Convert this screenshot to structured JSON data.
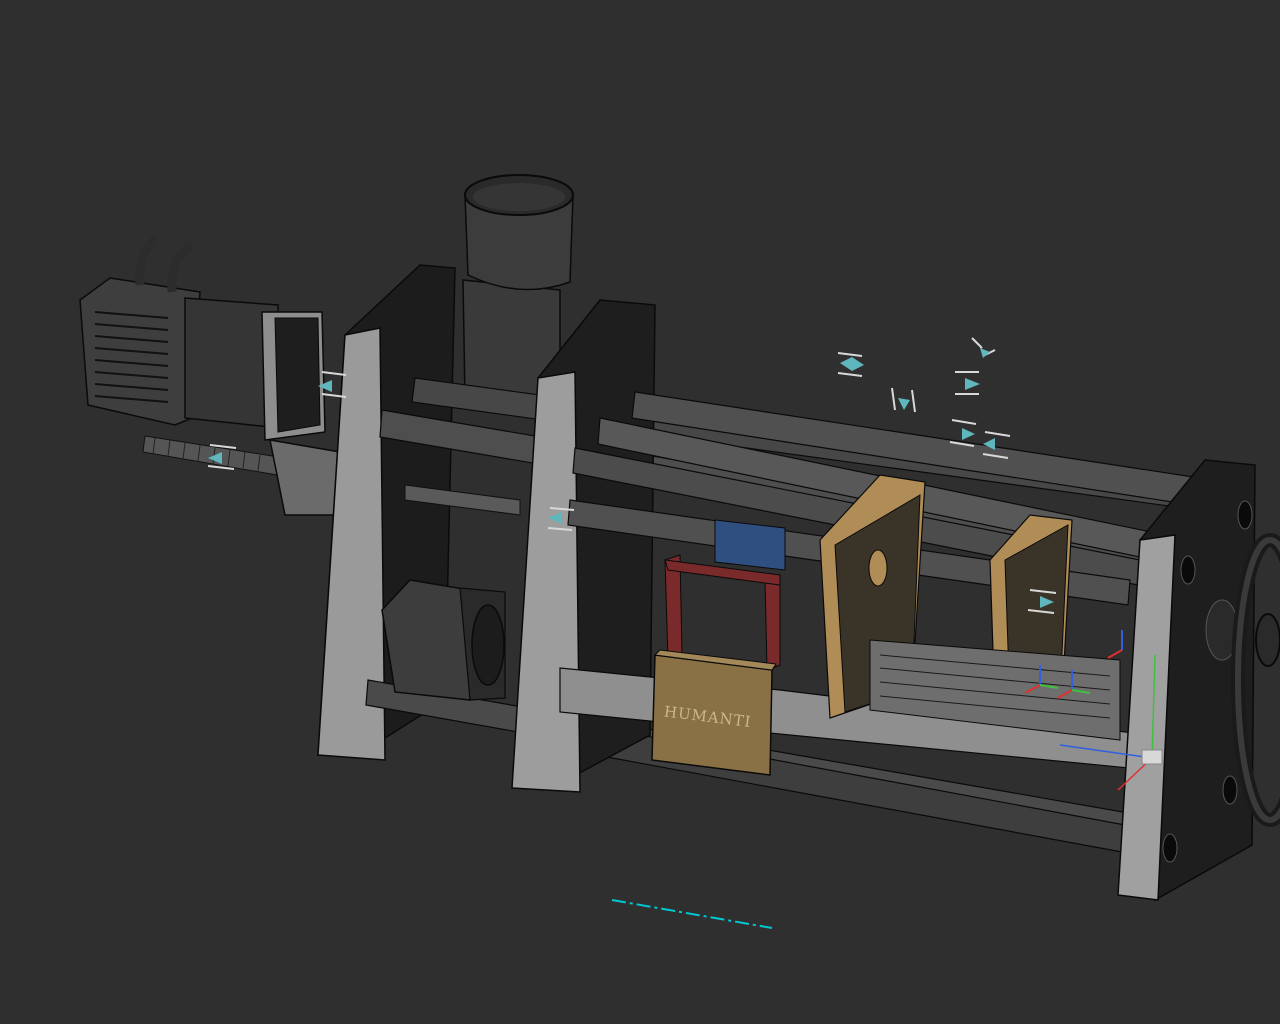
{
  "viewport": {
    "background": "#2f2f2f",
    "render_mode": "shaded-with-edges"
  },
  "model": {
    "plate_label": "HUMANTI",
    "colors": {
      "plate": "#8e8e8e",
      "plate_face": "#a3a3a3",
      "plate_dark": "#232323",
      "rod": "#4a4a4a",
      "rod_highlight": "#6a6a6a",
      "motor": "#3e3e3e",
      "brass": "#b08d57",
      "red_bracket": "#8a2f2f",
      "blue_coupling": "#2f4f80",
      "hopper": "#3a3a3a",
      "edge": "#0a0a0a",
      "constraint_marker": "#5fb6bd",
      "centerline": "#00c8d2"
    }
  },
  "gizmo": {
    "axis_x_color": "#e03030",
    "axis_y_color": "#40c040",
    "axis_z_color": "#3060e0"
  }
}
